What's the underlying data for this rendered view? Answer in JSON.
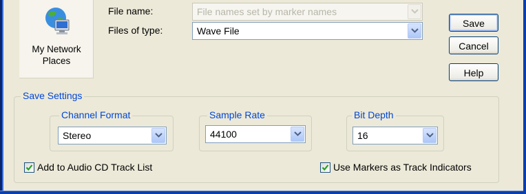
{
  "places": {
    "icon": "network-places-icon",
    "label_line1": "My Network",
    "label_line2": "Places"
  },
  "file_name": {
    "label": "File name:",
    "value": "File names set by marker names",
    "disabled": true
  },
  "file_type": {
    "label": "Files of type:",
    "value": "Wave File"
  },
  "buttons": {
    "save": "Save",
    "cancel": "Cancel",
    "help": "Help"
  },
  "save_settings": {
    "title": "Save Settings",
    "channel_format": {
      "title": "Channel Format",
      "value": "Stereo"
    },
    "sample_rate": {
      "title": "Sample Rate",
      "value": "44100"
    },
    "bit_depth": {
      "title": "Bit Depth",
      "value": "16"
    }
  },
  "checkboxes": {
    "add_to_cd": {
      "label": "Add to Audio CD Track List",
      "checked": true
    },
    "use_markers": {
      "label": "Use Markers as Track Indicators",
      "checked": true
    }
  },
  "colors": {
    "dialog_bg": "#ece9d8",
    "group_title": "#0046d5",
    "frame_blue": "#0a3fb0"
  }
}
